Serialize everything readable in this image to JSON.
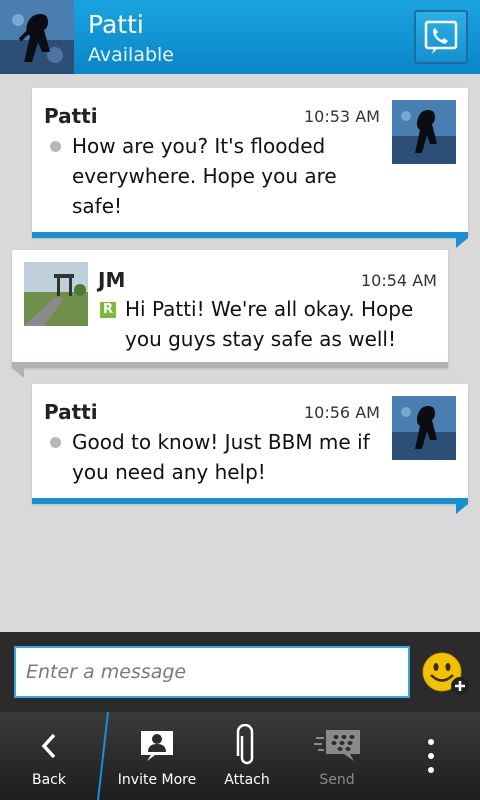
{
  "header": {
    "contact_name": "Patti",
    "status": "Available"
  },
  "messages": [
    {
      "sender": "Patti",
      "time": "10:53 AM",
      "lines": [
        "How are you? It's flooded",
        "everywhere. Hope you are",
        "safe!"
      ]
    },
    {
      "sender": "JM",
      "time": "10:54 AM",
      "badge": "R",
      "lines": [
        "Hi Patti! We're all okay. Hope",
        "you guys stay safe as well!"
      ]
    },
    {
      "sender": "Patti",
      "time": "10:56 AM",
      "lines": [
        "Good to know! Just BBM me if",
        "you need any help!"
      ]
    }
  ],
  "composer": {
    "placeholder": "Enter a message"
  },
  "actions": {
    "back": "Back",
    "invite": "Invite More",
    "attach": "Attach",
    "send": "Send"
  },
  "colors": {
    "accent": "#1a8fd4",
    "header": "#0a86c8",
    "read_badge": "#7fb93a"
  }
}
